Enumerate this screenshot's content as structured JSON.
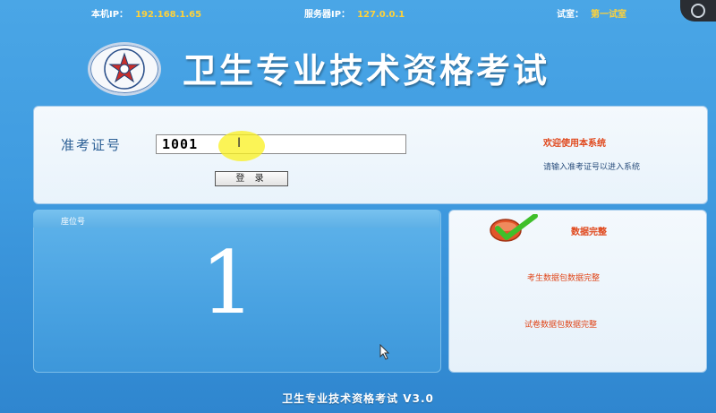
{
  "status": {
    "local_ip_label": "本机IP：",
    "local_ip": "192.168.1.65",
    "server_ip_label": "服务器IP：",
    "server_ip": "127.0.0.1",
    "room_label": "试室：",
    "room": "第一试室"
  },
  "header": {
    "title": "卫生专业技术资格考试"
  },
  "login": {
    "ticket_label": "准考证号",
    "ticket_value": "1001",
    "login_button": "登 录",
    "welcome_title": "欢迎使用本系统",
    "welcome_hint": "请输入准考证号以进入系统"
  },
  "seat": {
    "label": "座位号",
    "number": "1"
  },
  "data_status": {
    "title": "数据完整",
    "candidate_data": "考生数据包数据完整",
    "paper_data": "试卷数据包数据完整"
  },
  "footer": {
    "version": "卫生专业技术资格考试 V3.0"
  },
  "colors": {
    "background": "#3f9be0",
    "accent_orange": "#e0471b",
    "status_value": "#ffd23a"
  }
}
